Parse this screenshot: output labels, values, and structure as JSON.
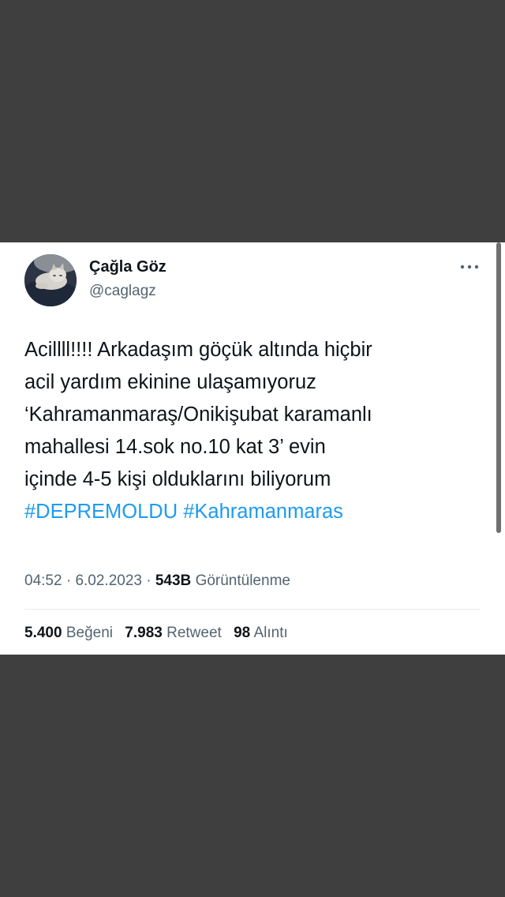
{
  "tweet": {
    "author": {
      "display_name": "Çağla Göz",
      "handle": "@caglagz"
    },
    "text_lines": [
      "Acillll!!!! Arkadaşım göçük altında hiçbir",
      "acil yardım ekinine ulaşamıyoruz",
      "‘Kahramanmaraş/Onikişubat karamanlı",
      "mahallesi 14.sok no.10 kat 3’ evin",
      "içinde 4-5 kişi olduklarını biliyorum"
    ],
    "hashtags": [
      "#DEPREMOLDU",
      "#Kahramanmaras"
    ],
    "time": "04:52",
    "separator": "·",
    "date": "6.02.2023",
    "views": {
      "count": "543B",
      "label": "Görüntülenme"
    },
    "stats": {
      "likes": {
        "count": "5.400",
        "label": "Beğeni"
      },
      "retweets": {
        "count": "7.983",
        "label": "Retweet"
      },
      "quotes": {
        "count": "98",
        "label": "Alıntı"
      }
    }
  },
  "colors": {
    "background": "#3f3f3f",
    "card": "#ffffff",
    "text_primary": "#0f1419",
    "text_secondary": "#536471",
    "link": "#1d9bf0",
    "divider": "#e7e9ea"
  },
  "icons": {
    "more": "more-horizontal-icon"
  }
}
